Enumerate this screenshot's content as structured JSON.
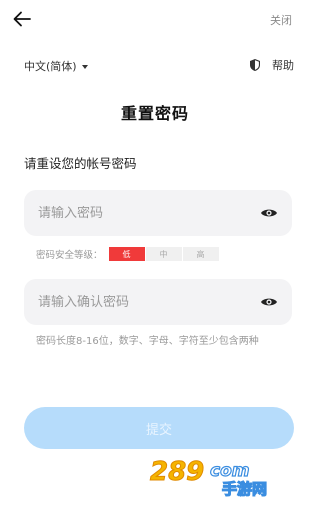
{
  "header": {
    "close_label": "关闭"
  },
  "language": {
    "selected": "中文(简体)"
  },
  "help": {
    "label": "帮助"
  },
  "page": {
    "title": "重置密码",
    "subtitle": "请重设您的帐号密码"
  },
  "password": {
    "placeholder": "请输入密码"
  },
  "strength": {
    "label": "密码安全等级：",
    "levels": [
      "低",
      "中",
      "高"
    ],
    "current": "低"
  },
  "confirm": {
    "placeholder": "请输入确认密码"
  },
  "hint": "密码长度8-16位，数字、字母、字符至少包含两种",
  "submit_label": "提交",
  "watermark": {
    "text": "手游网",
    "number": "289",
    "domain": "com"
  },
  "colors": {
    "accent_disabled": "#b6dcfb",
    "strength_low": "#f03a3a"
  }
}
